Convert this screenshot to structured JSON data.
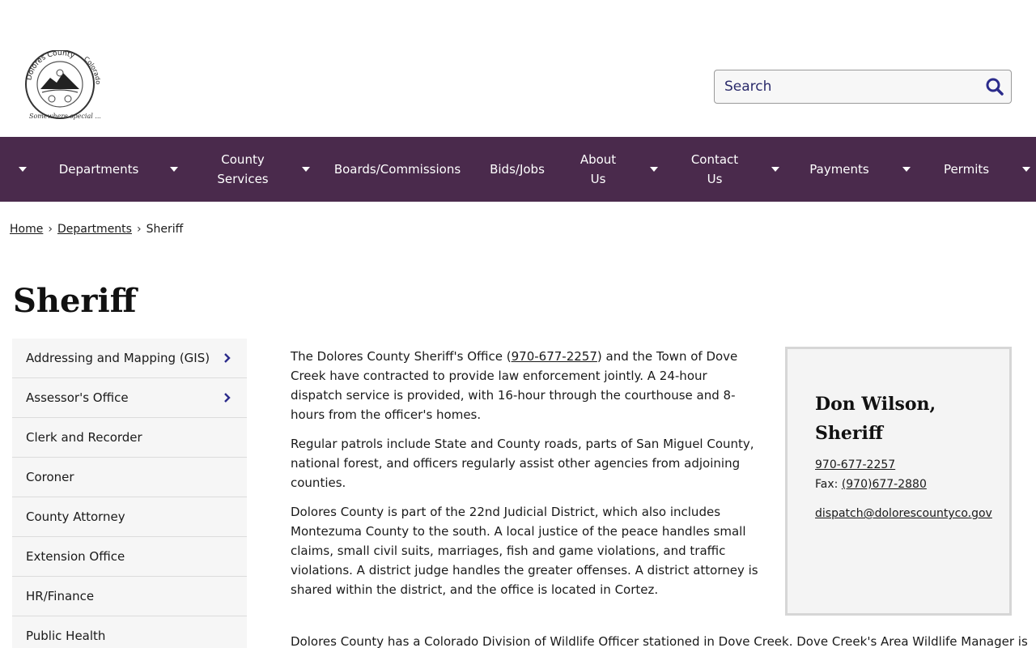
{
  "header": {
    "logo_text_top": "Dolores County",
    "logo_text_right": "Colorado",
    "logo_tagline": "Somewhere special ...",
    "search_placeholder": "Search"
  },
  "nav": {
    "items": [
      {
        "label": "Departments"
      },
      {
        "label": "County Services"
      },
      {
        "label": "Boards/Commissions"
      },
      {
        "label": "Bids/Jobs"
      },
      {
        "label": "About Us"
      },
      {
        "label": "Contact Us"
      },
      {
        "label": "Payments"
      },
      {
        "label": "Permits"
      }
    ]
  },
  "breadcrumb": {
    "home": "Home",
    "departments": "Departments",
    "current": "Sheriff",
    "separator": "›"
  },
  "page_title": "Sheriff",
  "sidebar": {
    "items": [
      {
        "label": "Addressing and Mapping (GIS)",
        "has_children": true
      },
      {
        "label": "Assessor's Office",
        "has_children": true
      },
      {
        "label": "Clerk and Recorder",
        "has_children": false
      },
      {
        "label": "Coroner",
        "has_children": false
      },
      {
        "label": "County Attorney",
        "has_children": false
      },
      {
        "label": "Extension Office",
        "has_children": false
      },
      {
        "label": "HR/Finance",
        "has_children": false
      },
      {
        "label": "Public Health",
        "has_children": false
      }
    ]
  },
  "content": {
    "p1_before": "The Dolores County Sheriff's Office (",
    "p1_phone": "970-677-2257",
    "p1_after": ") and the Town of Dove Creek have contracted to provide law enforcement jointly. A 24-hour dispatch service is provided, with 16-hour through the courthouse and 8-hours from the officer's homes.",
    "p2": "Regular patrols include State and County roads, parts of San Miguel County, national forest, and officers regularly assist other agencies from adjoining counties.",
    "p3": "Dolores County is part of the 22nd Judicial District, which also includes Montezuma County to the south. A local justice of the peace handles small claims, small civil suits, marriages, fish and game violations, and traffic violations. A district judge handles the greater offenses. A district attorney is shared within the district, and the office is located in Cortez.",
    "p4": "Dolores County has a Colorado Division of Wildlife Officer stationed in Dove Creek. Dove Creek's Area Wildlife Manager is"
  },
  "contact_card": {
    "name": "Don Wilson, Sheriff",
    "phone": "970-677-2257",
    "fax_label": "Fax: ",
    "fax": "(970)677-2880",
    "email": "dispatch@dolorescountyco.gov"
  },
  "colors": {
    "nav_bg": "#4a2a4c",
    "accent_link": "#1a1a1a",
    "search_icon": "#2b2b8b"
  }
}
